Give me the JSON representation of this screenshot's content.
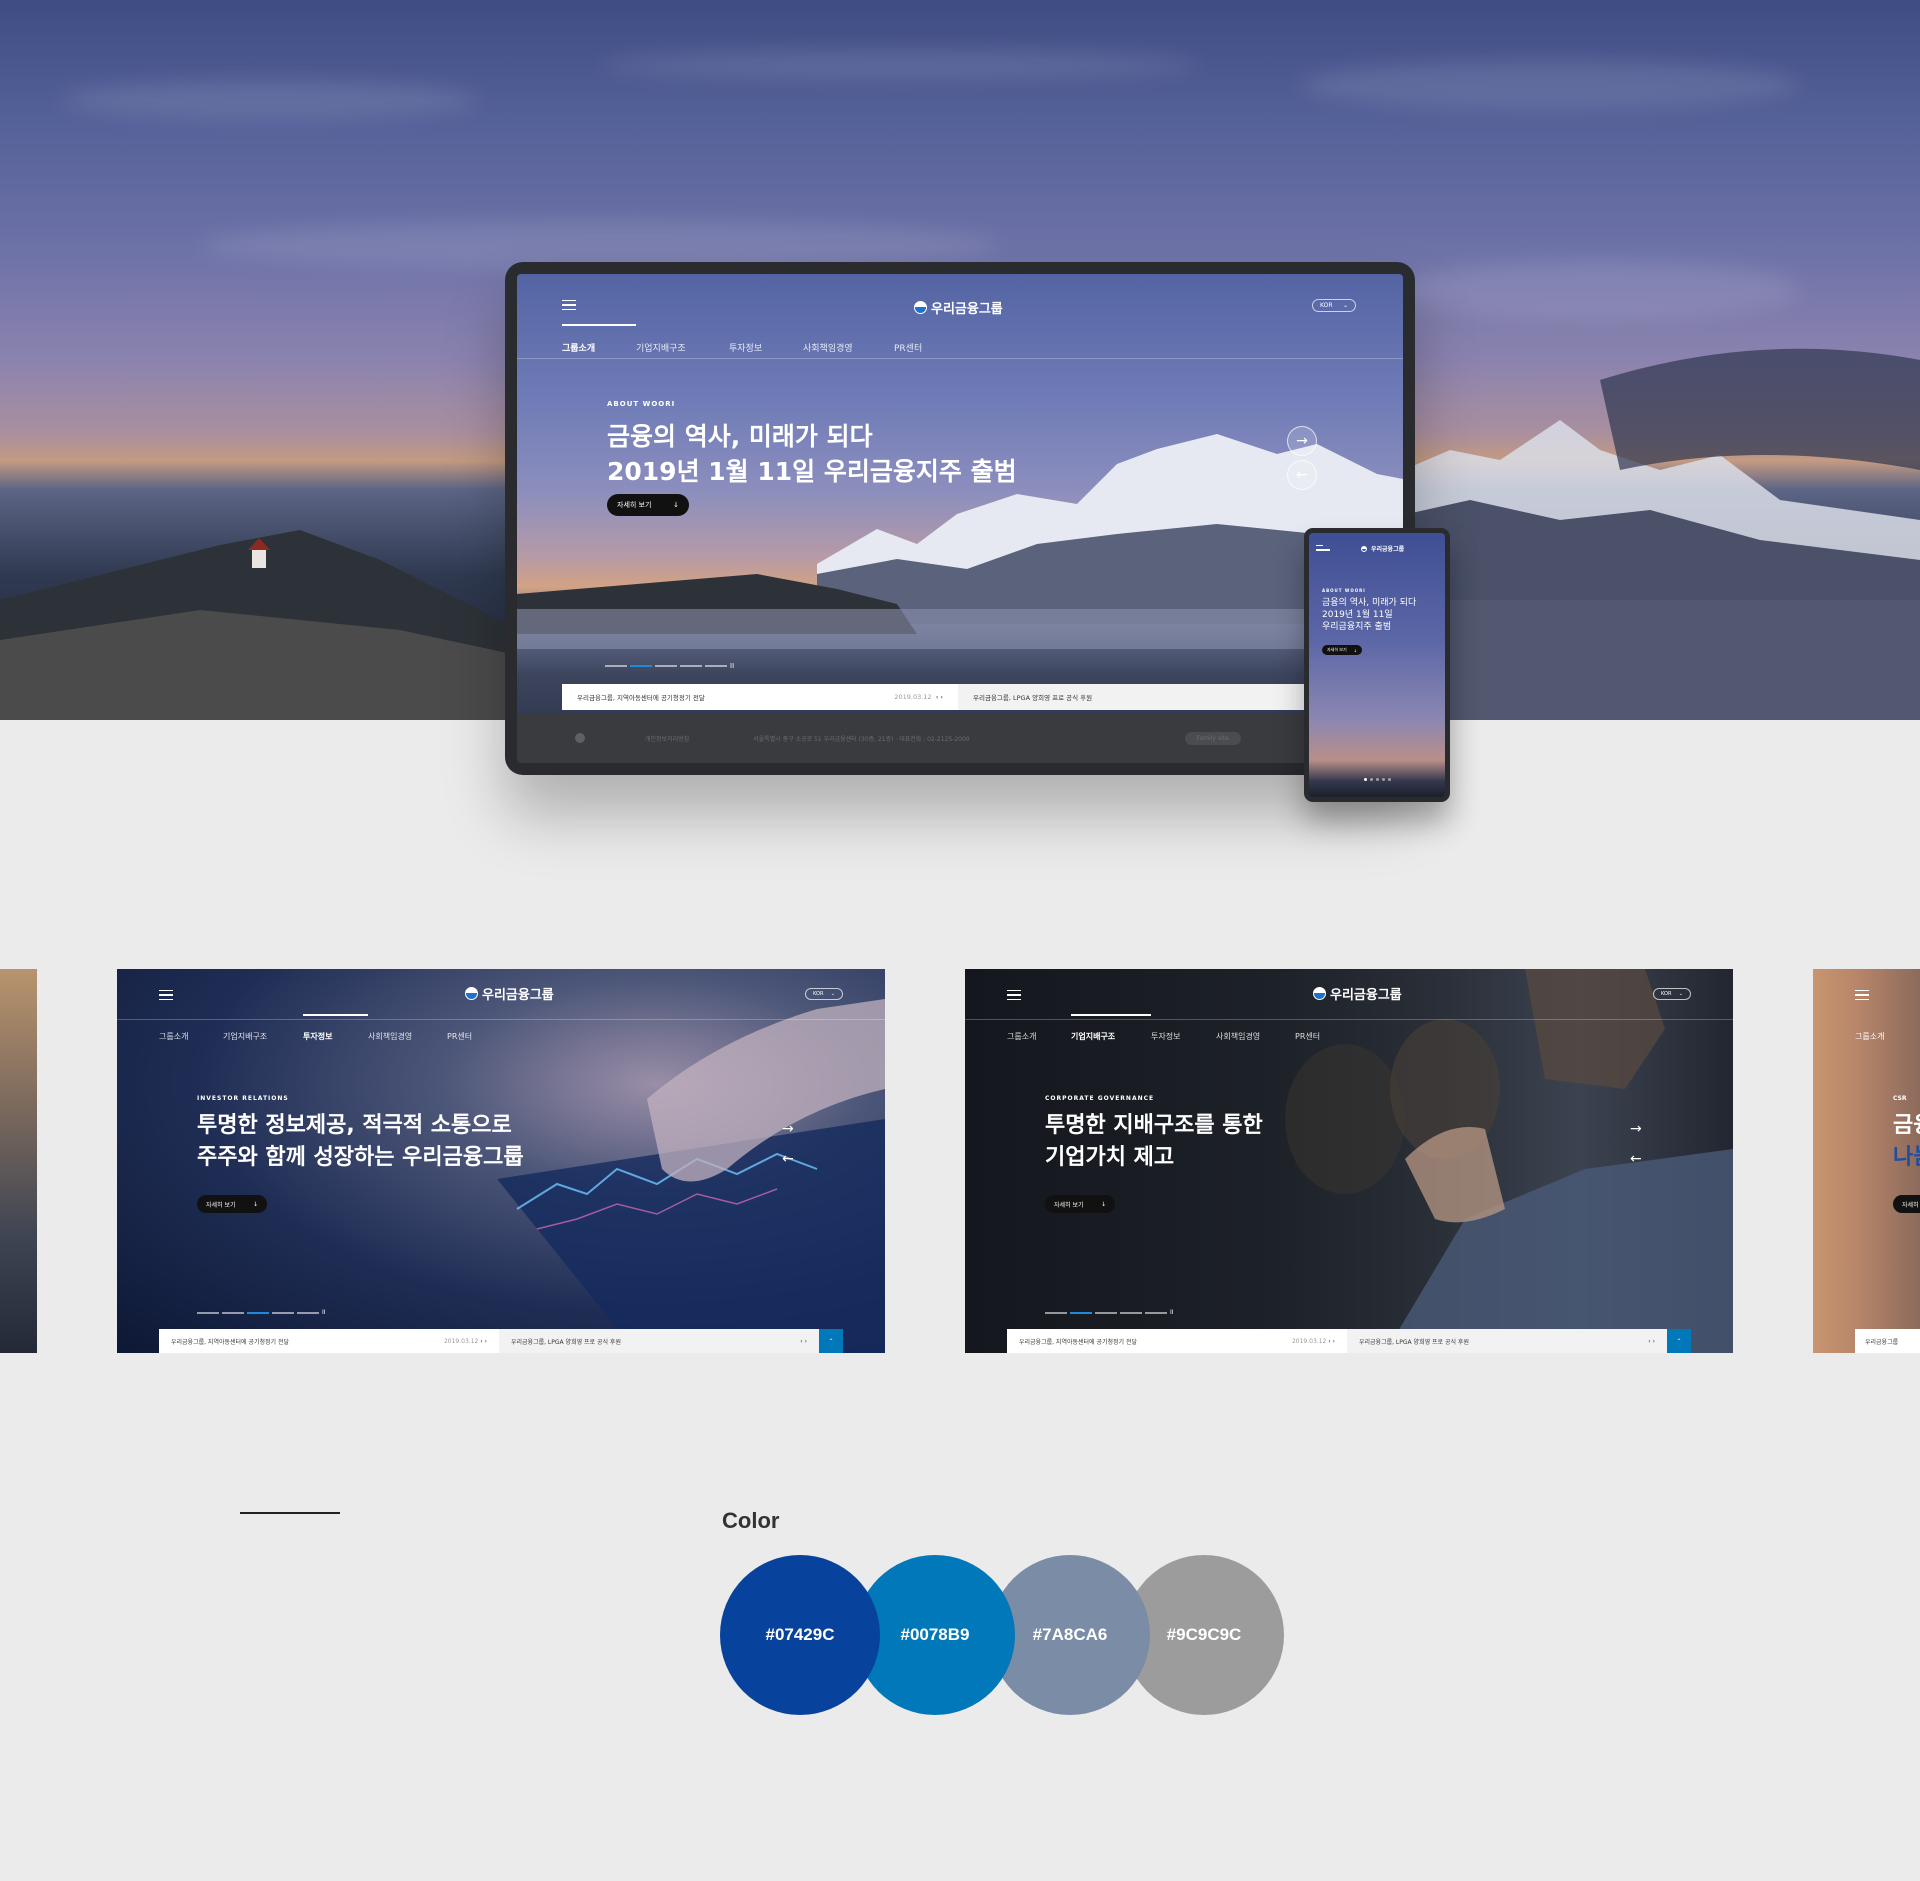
{
  "site": {
    "logo_text": "우리금융그룹",
    "lang": "KOR",
    "nav": [
      "그룹소개",
      "기업지배구조",
      "투자정보",
      "사회책임경영",
      "PR센터"
    ],
    "more_label": "자세히 보기",
    "news_item_1": "우리금융그룹, 지역아동센터에 공기청정기 전달",
    "news_date": "2019.03.12",
    "news_item_2": "우리금융그룹, LPGA 양희영 프로 공식 후원"
  },
  "laptop": {
    "eyebrow": "ABOUT WOORI",
    "headline_line1": "금융의 역사, 미래가 되다",
    "headline_line2": "2019년 1월 11일 우리금융지주 출범",
    "footer_privacy": "개인정보처리방침",
    "footer_address": "서울특별시 중구 소공로 51 우리금융센터 (30층, 21층) · 대표전화 : 02-2125-2000",
    "footer_family": "Family site"
  },
  "phone": {
    "eyebrow": "ABOUT WOORI",
    "headline_line1": "금융의 역사, 미래가 되다",
    "headline_line2": "2019년 1월 11일",
    "headline_line3": "우리금융지주 출범"
  },
  "slide_ir": {
    "eyebrow": "INVESTOR RELATIONS",
    "headline_line1": "투명한 정보제공, 적극적 소통으로",
    "headline_line2": "주주와 함께 성장하는 우리금융그룹"
  },
  "slide_cg": {
    "eyebrow": "CORPORATE GOVERNANCE",
    "headline_line1": "투명한 지배구조를 통한",
    "headline_line2": "기업가치 제고"
  },
  "slide_csr": {
    "nav_item": "그룹소개",
    "eyebrow": "CSR",
    "headline_line1": "금융",
    "headline_line2": "나눔",
    "more_label": "자세히",
    "news_item": "우리금융그룹"
  },
  "color_section": {
    "title": "Color",
    "swatches": [
      {
        "label": "#07429C",
        "color": "#07429C"
      },
      {
        "label": "#0078B9",
        "color": "#0078B9"
      },
      {
        "label": "#7A8CA6",
        "color": "#7A8CA6"
      },
      {
        "label": "#9C9C9C",
        "color": "#9C9C9C"
      }
    ]
  }
}
